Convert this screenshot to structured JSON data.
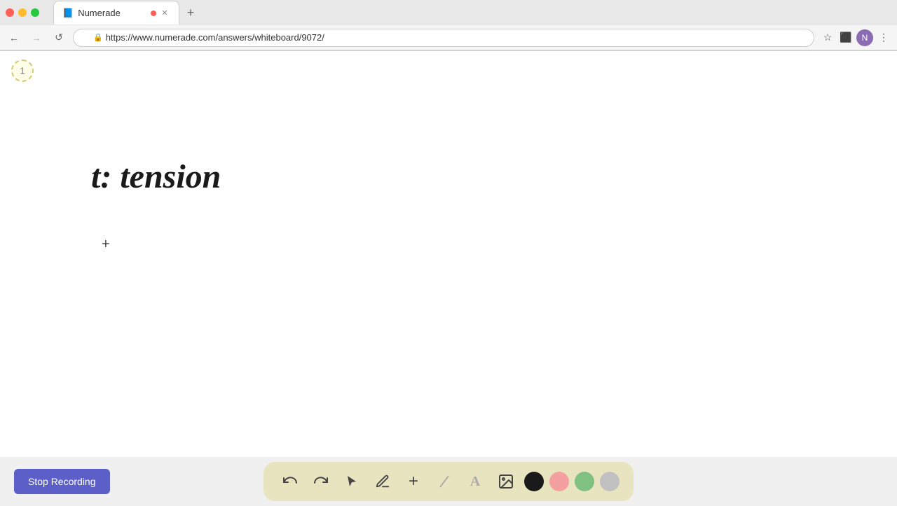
{
  "browser": {
    "window_controls": {
      "close_color": "#ff5f56",
      "min_color": "#ffbd2e",
      "max_color": "#27c93f"
    },
    "tab": {
      "title": "Numerade",
      "favicon": "📘",
      "close_indicator": "●"
    },
    "new_tab_label": "+",
    "address_bar": {
      "url": "https://www.numerade.com/answers/whiteboard/9072/",
      "lock_icon": "🔒"
    },
    "nav": {
      "back": "←",
      "forward": "→",
      "refresh": "↺"
    }
  },
  "whiteboard": {
    "page_number": "1",
    "content_text": "t:  tension",
    "cursor": "+"
  },
  "toolbar": {
    "stop_recording_label": "Stop Recording",
    "tools": [
      {
        "name": "undo",
        "icon": "↺",
        "label": "Undo"
      },
      {
        "name": "redo",
        "icon": "↻",
        "label": "Redo"
      },
      {
        "name": "select",
        "icon": "▲",
        "label": "Select"
      },
      {
        "name": "pen",
        "icon": "✏️",
        "label": "Pen"
      },
      {
        "name": "add",
        "icon": "+",
        "label": "Add"
      },
      {
        "name": "eraser",
        "icon": "/",
        "label": "Eraser"
      },
      {
        "name": "text",
        "icon": "A",
        "label": "Text"
      },
      {
        "name": "image",
        "icon": "🖼",
        "label": "Image"
      }
    ],
    "colors": [
      {
        "name": "black",
        "value": "#1a1a1a"
      },
      {
        "name": "pink",
        "value": "#f4a0a0"
      },
      {
        "name": "green",
        "value": "#80c080"
      },
      {
        "name": "gray",
        "value": "#c0c0c0"
      }
    ]
  }
}
